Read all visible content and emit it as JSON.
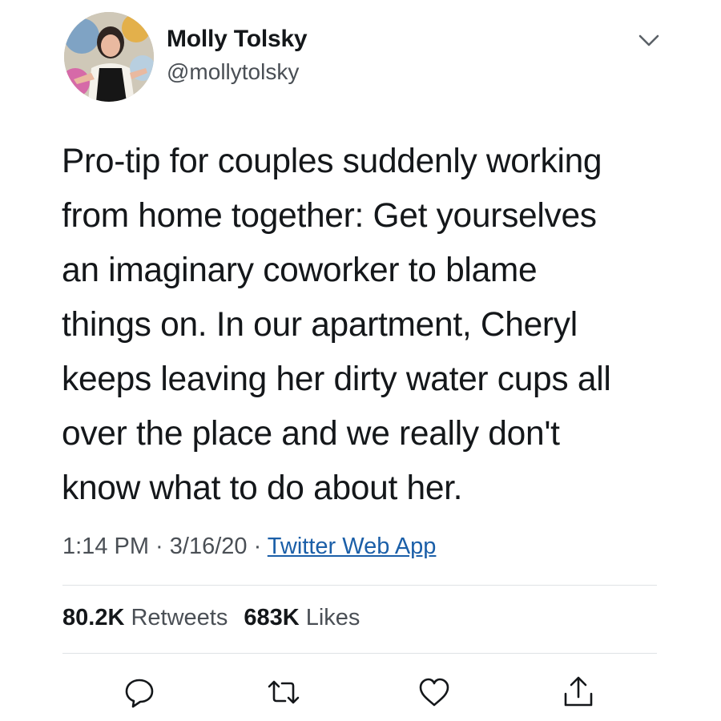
{
  "author": {
    "display_name": "Molly Tolsky",
    "handle": "@mollytolsky",
    "avatar_icon": "profile-photo"
  },
  "tweet": {
    "text": "Pro-tip for couples suddenly working\nfrom home together: Get yourselves\nan imaginary coworker to blame\nthings on. In our apartment, Cheryl\nkeeps leaving her dirty water cups all\nover the place and we really don't\nknow what to do about her.",
    "time": "1:14 PM",
    "separator": " · ",
    "date": "3/16/20",
    "source": "Twitter Web App"
  },
  "stats": {
    "retweets_count": "80.2K",
    "retweets_label": "Retweets",
    "likes_count": "683K",
    "likes_label": "Likes"
  },
  "actions": {
    "reply_icon": "reply-icon",
    "retweet_icon": "retweet-icon",
    "like_icon": "heart-icon",
    "share_icon": "share-icon"
  },
  "colors": {
    "text": "#14171a",
    "secondary": "#4a4f55",
    "link": "#1b5fa8",
    "divider": "#dfe2e5"
  }
}
